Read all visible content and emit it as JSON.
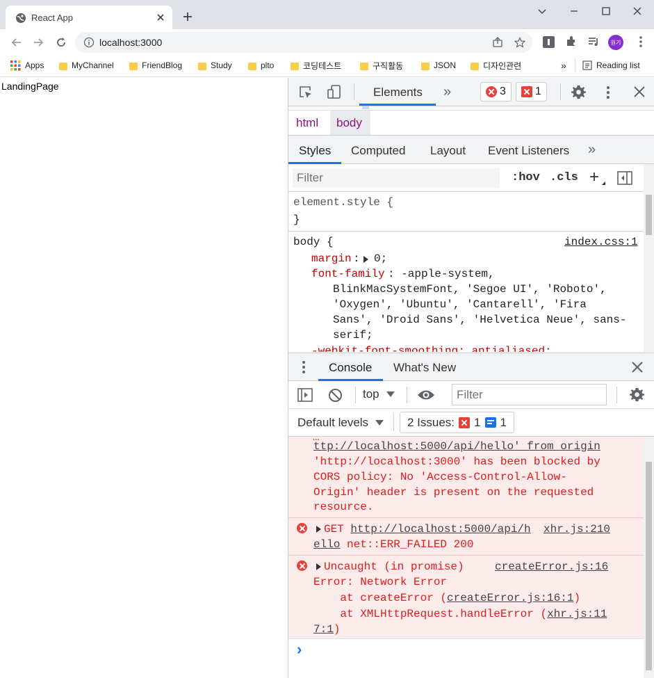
{
  "tab": {
    "title": "React App",
    "favicon_icon": "globe-icon"
  },
  "address": {
    "url": "localhost:3000"
  },
  "profile": {
    "initials": "원기",
    "color": "#8430ce"
  },
  "bookmarks": {
    "apps": "Apps",
    "items": [
      "MyChannel",
      "FriendBlog",
      "Study",
      "plto",
      "코딩테스트",
      "구직활동",
      "JSON",
      "디자인관련"
    ],
    "more": "»",
    "reading_list": "Reading list"
  },
  "page": {
    "text": "LandingPage"
  },
  "devtools": {
    "elements_tab": "Elements",
    "more_tabs": "»",
    "errors_count": "3",
    "issues_count": "1",
    "breadcrumb": [
      "html",
      "body"
    ],
    "style_tabs": [
      "Styles",
      "Computed",
      "Layout",
      "Event Listeners"
    ],
    "style_more": "»",
    "filter_placeholder": "Filter",
    "hov": ":hov",
    "cls": ".cls",
    "plus": "+",
    "element_style_open": "element.style {",
    "element_style_close": "}",
    "rule_selector": "body {",
    "rule_source": "index.css:1",
    "margin_prop": "margin",
    "margin_val": "0;",
    "font_prop": "font-family",
    "font_val_lines": [
      ": -apple-system,",
      "BlinkMacSystemFont, 'Segoe UI', 'Roboto',",
      "'Oxygen', 'Ubuntu', 'Cantarell', 'Fira",
      "Sans', 'Droid Sans', 'Helvetica Neue', sans-",
      "serif;"
    ],
    "cutoff_line": "-webkit-font-smoothing: antialiased;"
  },
  "drawer": {
    "console_tab": "Console",
    "whats_new_tab": "What's New",
    "context": "top",
    "filter_placeholder": "Filter",
    "levels": "Default levels",
    "issues_label": "2 Issues:",
    "issues_err": "1",
    "issues_info": "1"
  },
  "console": {
    "cors_lines": [
      "ttp://localhost:5000/api/hello' from origin",
      "'http://localhost:3000' has been blocked by",
      "CORS policy: No 'Access-Control-Allow-",
      "Origin' header is present on the requested",
      "resource."
    ],
    "get_prefix": "GET ",
    "get_url_1": "http://localhost:5000/api/h",
    "get_url_2": "ello",
    "get_status": " net::ERR_FAILED 200",
    "get_source": "xhr.js:210",
    "uncaught_1": "Uncaught (in promise)",
    "uncaught_source": "createError.js:16",
    "uncaught_2": "Error: Network Error",
    "at1_prefix": "    at createError (",
    "at1_link": "createError.js:16:1",
    "at1_suffix": ")",
    "at2_prefix": "    at XMLHttpRequest.handleError (",
    "at2_link_1": "xhr.js:11",
    "at2_link_2": "7:1",
    "at2_suffix": ")",
    "prompt": "›"
  }
}
